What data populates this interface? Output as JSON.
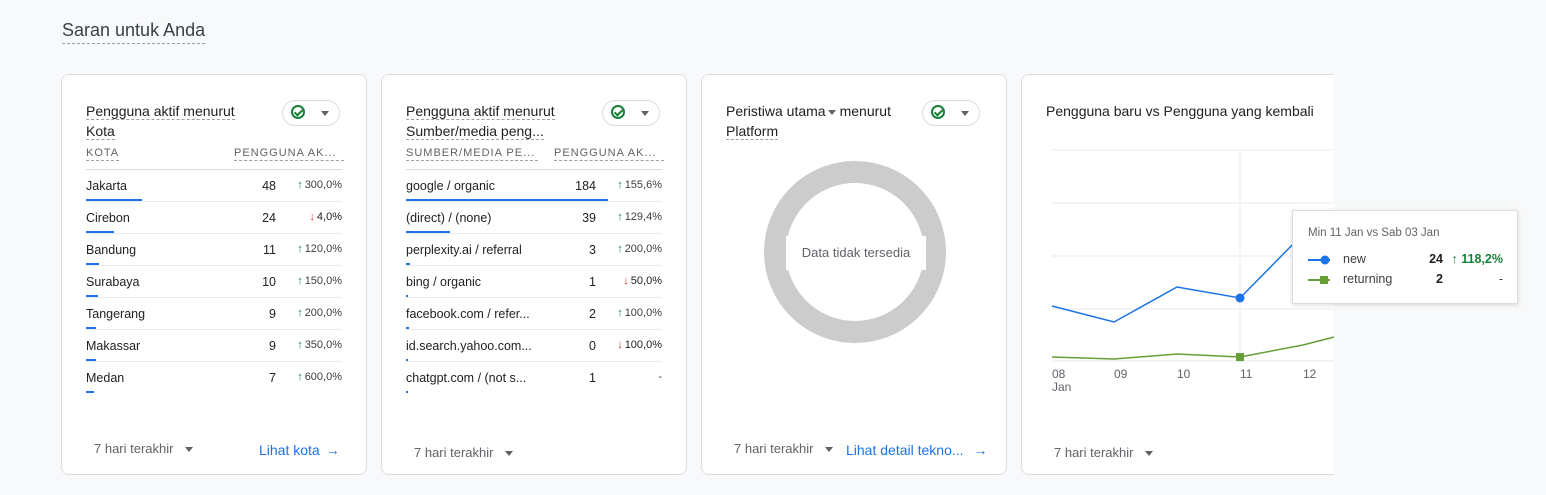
{
  "section": {
    "title": "Saran untuk Anda"
  },
  "card1": {
    "title": "Pengguna aktif menurut Kota",
    "col1": "KOTA",
    "col2": "PENGGUNA AK...",
    "rows": [
      {
        "name": "Jakarta",
        "value": "48",
        "change": "300,0%",
        "dir": "up",
        "bar": 0.22
      },
      {
        "name": "Cirebon",
        "value": "24",
        "change": "4,0%",
        "dir": "down",
        "bar": 0.11
      },
      {
        "name": "Bandung",
        "value": "11",
        "change": "120,0%",
        "dir": "up",
        "bar": 0.05
      },
      {
        "name": "Surabaya",
        "value": "10",
        "change": "150,0%",
        "dir": "up",
        "bar": 0.045
      },
      {
        "name": "Tangerang",
        "value": "9",
        "change": "200,0%",
        "dir": "up",
        "bar": 0.04
      },
      {
        "name": "Makassar",
        "value": "9",
        "change": "350,0%",
        "dir": "up",
        "bar": 0.04
      },
      {
        "name": "Medan",
        "value": "7",
        "change": "600,0%",
        "dir": "up",
        "bar": 0.03
      }
    ],
    "range": "7 hari terakhir",
    "link": "Lihat kota"
  },
  "card2": {
    "title": "Pengguna aktif menurut Sumber/media peng...",
    "col1": "SUMBER/MEDIA PE...",
    "col2": "PENGGUNA AK...",
    "rows": [
      {
        "name": "google / organic",
        "value": "184",
        "change": "155,6%",
        "dir": "up",
        "bar": 0.79
      },
      {
        "name": "(direct) / (none)",
        "value": "39",
        "change": "129,4%",
        "dir": "up",
        "bar": 0.17
      },
      {
        "name": "perplexity.ai / referral",
        "value": "3",
        "change": "200,0%",
        "dir": "up",
        "bar": 0.015
      },
      {
        "name": "bing / organic",
        "value": "1",
        "change": "50,0%",
        "dir": "down",
        "bar": 0.005
      },
      {
        "name": "facebook.com / refer...",
        "value": "2",
        "change": "100,0%",
        "dir": "up",
        "bar": 0.01
      },
      {
        "name": "id.search.yahoo.com...",
        "value": "0",
        "change": "100,0%",
        "dir": "down",
        "bar": 0
      },
      {
        "name": "chatgpt.com / (not s...",
        "value": "1",
        "change": "-",
        "dir": "none",
        "bar": 0.005
      }
    ],
    "range": "7 hari terakhir"
  },
  "card3": {
    "title_part1": "Peristiwa utama",
    "title_part2": "menurut",
    "title_part3": "Platform",
    "empty": "Data tidak tersedia",
    "range": "7 hari terakhir",
    "link": "Lihat detail tekno..."
  },
  "card4": {
    "title": "Pengguna baru vs Pengguna yang kembali",
    "range": "7 hari terakhir",
    "x_labels": [
      "08",
      "09",
      "10",
      "11",
      "12"
    ],
    "x_sub": "Jan",
    "legend": {
      "new": "new",
      "returning": "returning"
    },
    "tooltip": {
      "title": "Min 11 Jan vs Sab 03 Jan",
      "new_label": "new",
      "new_value": "24",
      "new_change": "118,2%",
      "ret_label": "returning",
      "ret_value": "2",
      "ret_change": "-"
    },
    "colors": {
      "new": "#1a73e8",
      "returning": "#679e37"
    }
  },
  "chart_data": {
    "type": "line",
    "categories": [
      "08 Jan",
      "09 Jan",
      "10 Jan",
      "11 Jan",
      "12 Jan"
    ],
    "series": [
      {
        "name": "new",
        "values": [
          null,
          null,
          null,
          24,
          null
        ]
      },
      {
        "name": "returning",
        "values": [
          null,
          null,
          null,
          2,
          null
        ]
      }
    ]
  }
}
